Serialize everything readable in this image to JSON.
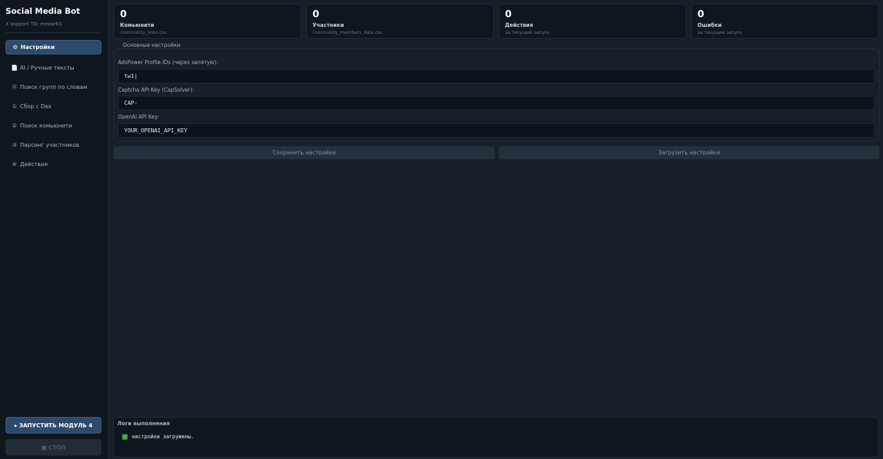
{
  "sidebar": {
    "title": "Social Media Bot",
    "subtitle": "X support TG: mezar63",
    "items": [
      {
        "icon": "⚙",
        "label": "Настройки",
        "active": true
      },
      {
        "icon": "📄",
        "label": "AI / Ручные тексты",
        "active": false
      },
      {
        "icon": "⓪",
        "label": "Поиск групп по словам",
        "active": false
      },
      {
        "icon": "①",
        "label": "Сбор с Dex",
        "active": false
      },
      {
        "icon": "②",
        "label": "Поиск комьюнити",
        "active": false
      },
      {
        "icon": "③",
        "label": "Парсинг участников",
        "active": false
      },
      {
        "icon": "④",
        "label": "Действия",
        "active": false
      }
    ],
    "run_label": "▸ ЗАПУСТИТЬ МОДУЛЬ 4",
    "stop_label": "■ СТОП"
  },
  "stats": [
    {
      "value": "0",
      "label": "Комьюнити",
      "sub": "community_links.csv"
    },
    {
      "value": "0",
      "label": "Участники",
      "sub": "community_members_data.csv"
    },
    {
      "value": "0",
      "label": "Действия",
      "sub": "за текущий запуск"
    },
    {
      "value": "0",
      "label": "Ошибки",
      "sub": "за текущий запуск"
    }
  ],
  "settings": {
    "legend": "Основные настройки",
    "fields": [
      {
        "label": "AdsPower Profile IDs (через запятую):",
        "value": "tw1|"
      },
      {
        "label": "Captcha API Key (CapSolver):",
        "value": "CAP-"
      },
      {
        "label": "OpenAI API Key:",
        "value": "YOUR_OPENAI_API_KEY"
      }
    ],
    "save_label": "Сохранить настройки",
    "load_label": "Загрузить настройки"
  },
  "logs": {
    "title": "Логи выполнения",
    "lines": [
      {
        "icon": "✓",
        "text": "настройки загружены."
      }
    ]
  },
  "colors": {
    "accent": "#2c4a6b",
    "success": "#2ea043",
    "background": "#17202a",
    "panel": "#0f161e"
  }
}
